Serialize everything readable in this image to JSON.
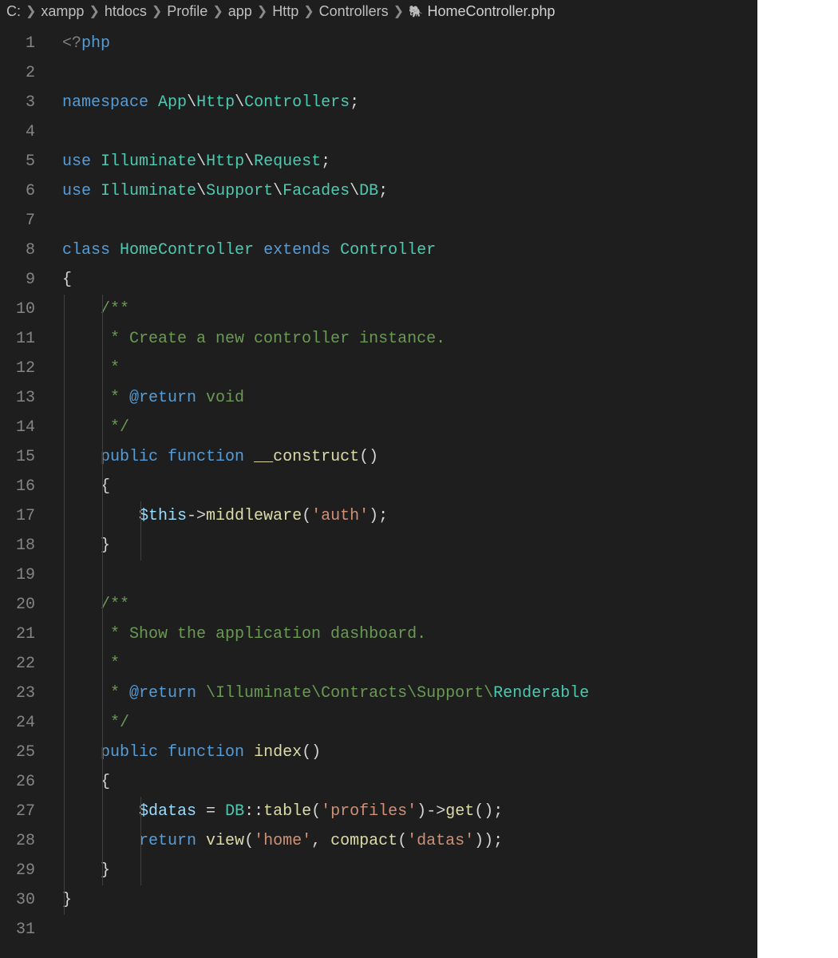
{
  "breadcrumb": {
    "segments": [
      "C:",
      "xampp",
      "htdocs",
      "Profile",
      "app",
      "Http",
      "Controllers"
    ],
    "file_icon": "php-elephant-icon",
    "file_icon_glyph": "🐘",
    "filename": "HomeController.php"
  },
  "line_count": 31,
  "code_lines": [
    [
      [
        "t-tag",
        "<?"
      ],
      [
        "t-kw",
        "php"
      ]
    ],
    [],
    [
      [
        "t-kw",
        "namespace"
      ],
      [
        "t-pun",
        " "
      ],
      [
        "t-ns",
        "App"
      ],
      [
        "t-pun",
        "\\"
      ],
      [
        "t-ns",
        "Http"
      ],
      [
        "t-pun",
        "\\"
      ],
      [
        "t-ns",
        "Controllers"
      ],
      [
        "t-pun",
        ";"
      ]
    ],
    [],
    [
      [
        "t-kw",
        "use"
      ],
      [
        "t-pun",
        " "
      ],
      [
        "t-ns",
        "Illuminate"
      ],
      [
        "t-pun",
        "\\"
      ],
      [
        "t-ns",
        "Http"
      ],
      [
        "t-pun",
        "\\"
      ],
      [
        "t-ns",
        "Request"
      ],
      [
        "t-pun",
        ";"
      ]
    ],
    [
      [
        "t-kw",
        "use"
      ],
      [
        "t-pun",
        " "
      ],
      [
        "t-ns",
        "Illuminate"
      ],
      [
        "t-pun",
        "\\"
      ],
      [
        "t-ns",
        "Support"
      ],
      [
        "t-pun",
        "\\"
      ],
      [
        "t-ns",
        "Facades"
      ],
      [
        "t-pun",
        "\\"
      ],
      [
        "t-ns",
        "DB"
      ],
      [
        "t-pun",
        ";"
      ]
    ],
    [],
    [
      [
        "t-kw",
        "class"
      ],
      [
        "t-pun",
        " "
      ],
      [
        "t-cls",
        "HomeController"
      ],
      [
        "t-pun",
        " "
      ],
      [
        "t-kw",
        "extends"
      ],
      [
        "t-pun",
        " "
      ],
      [
        "t-cls",
        "Controller"
      ]
    ],
    [
      [
        "t-pun",
        "{"
      ]
    ],
    [
      [
        "t-pun",
        "    "
      ],
      [
        "t-com",
        "/**"
      ]
    ],
    [
      [
        "t-pun",
        "     "
      ],
      [
        "t-com",
        "* Create a new controller instance."
      ]
    ],
    [
      [
        "t-pun",
        "     "
      ],
      [
        "t-com",
        "*"
      ]
    ],
    [
      [
        "t-pun",
        "     "
      ],
      [
        "t-com",
        "* "
      ],
      [
        "t-doc",
        "@return"
      ],
      [
        "t-com",
        " void"
      ]
    ],
    [
      [
        "t-pun",
        "     "
      ],
      [
        "t-com",
        "*/"
      ]
    ],
    [
      [
        "t-pun",
        "    "
      ],
      [
        "t-kw",
        "public"
      ],
      [
        "t-pun",
        " "
      ],
      [
        "t-kw",
        "function"
      ],
      [
        "t-pun",
        " "
      ],
      [
        "t-fn",
        "__construct"
      ],
      [
        "t-pun",
        "()"
      ]
    ],
    [
      [
        "t-pun",
        "    {"
      ]
    ],
    [
      [
        "t-pun",
        "        "
      ],
      [
        "t-var",
        "$this"
      ],
      [
        "t-op",
        "->"
      ],
      [
        "t-fn",
        "middleware"
      ],
      [
        "t-pun",
        "("
      ],
      [
        "t-str",
        "'auth'"
      ],
      [
        "t-pun",
        ");"
      ]
    ],
    [
      [
        "t-pun",
        "    }"
      ]
    ],
    [],
    [
      [
        "t-pun",
        "    "
      ],
      [
        "t-com",
        "/**"
      ]
    ],
    [
      [
        "t-pun",
        "     "
      ],
      [
        "t-com",
        "* Show the application dashboard."
      ]
    ],
    [
      [
        "t-pun",
        "     "
      ],
      [
        "t-com",
        "*"
      ]
    ],
    [
      [
        "t-pun",
        "     "
      ],
      [
        "t-com",
        "* "
      ],
      [
        "t-doc",
        "@return"
      ],
      [
        "t-com",
        " \\Illuminate\\Contracts\\Support\\"
      ],
      [
        "t-cls",
        "Renderable"
      ]
    ],
    [
      [
        "t-pun",
        "     "
      ],
      [
        "t-com",
        "*/"
      ]
    ],
    [
      [
        "t-pun",
        "    "
      ],
      [
        "t-kw",
        "public"
      ],
      [
        "t-pun",
        " "
      ],
      [
        "t-kw",
        "function"
      ],
      [
        "t-pun",
        " "
      ],
      [
        "t-fn",
        "index"
      ],
      [
        "t-pun",
        "()"
      ]
    ],
    [
      [
        "t-pun",
        "    {"
      ]
    ],
    [
      [
        "t-pun",
        "        "
      ],
      [
        "t-var",
        "$datas"
      ],
      [
        "t-pun",
        " "
      ],
      [
        "t-op",
        "="
      ],
      [
        "t-pun",
        " "
      ],
      [
        "t-cls",
        "DB"
      ],
      [
        "t-op",
        "::"
      ],
      [
        "t-fn",
        "table"
      ],
      [
        "t-pun",
        "("
      ],
      [
        "t-str",
        "'profiles'"
      ],
      [
        "t-pun",
        ")"
      ],
      [
        "t-op",
        "->"
      ],
      [
        "t-fn",
        "get"
      ],
      [
        "t-pun",
        "();"
      ]
    ],
    [
      [
        "t-pun",
        "        "
      ],
      [
        "t-kw",
        "return"
      ],
      [
        "t-pun",
        " "
      ],
      [
        "t-fn",
        "view"
      ],
      [
        "t-pun",
        "("
      ],
      [
        "t-str",
        "'home'"
      ],
      [
        "t-pun",
        ", "
      ],
      [
        "t-fn",
        "compact"
      ],
      [
        "t-pun",
        "("
      ],
      [
        "t-str",
        "'datas'"
      ],
      [
        "t-pun",
        "));"
      ]
    ],
    [
      [
        "t-pun",
        "    }"
      ]
    ],
    [
      [
        "t-pun",
        "}"
      ]
    ],
    []
  ]
}
